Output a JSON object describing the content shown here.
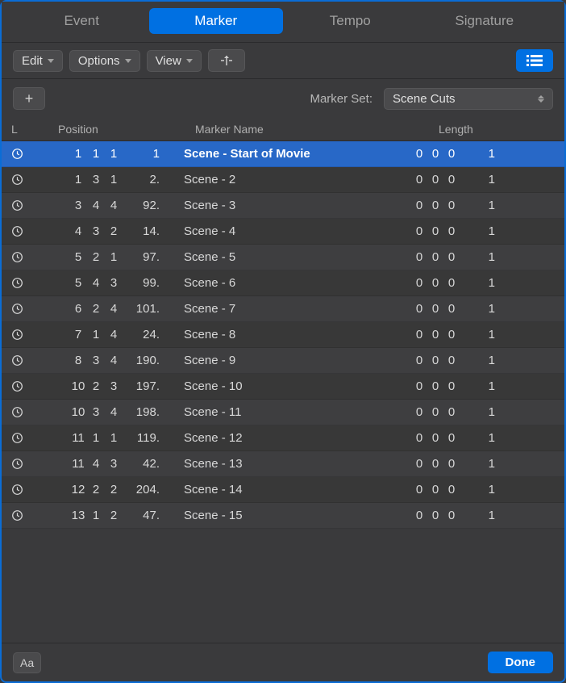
{
  "tabs": {
    "items": [
      {
        "label": "Event"
      },
      {
        "label": "Marker"
      },
      {
        "label": "Tempo"
      },
      {
        "label": "Signature"
      }
    ],
    "active_index": 1
  },
  "toolbar": {
    "edit": "Edit",
    "options": "Options",
    "view": "View"
  },
  "markerset": {
    "label": "Marker Set:",
    "value": "Scene Cuts"
  },
  "columns": {
    "l": "L",
    "position": "Position",
    "name": "Marker Name",
    "length": "Length"
  },
  "rows": [
    {
      "p1": "1",
      "p2": "1",
      "p3": "1",
      "p4": "1",
      "dot": false,
      "name": "Scene - Start of Movie",
      "l1": "0",
      "l2": "0",
      "l3": "0",
      "l4": "1",
      "selected": true
    },
    {
      "p1": "1",
      "p2": "3",
      "p3": "1",
      "p4": "2",
      "dot": true,
      "name": "Scene - 2",
      "l1": "0",
      "l2": "0",
      "l3": "0",
      "l4": "1"
    },
    {
      "p1": "3",
      "p2": "4",
      "p3": "4",
      "p4": "92",
      "dot": true,
      "name": "Scene - 3",
      "l1": "0",
      "l2": "0",
      "l3": "0",
      "l4": "1"
    },
    {
      "p1": "4",
      "p2": "3",
      "p3": "2",
      "p4": "14",
      "dot": true,
      "name": "Scene - 4",
      "l1": "0",
      "l2": "0",
      "l3": "0",
      "l4": "1"
    },
    {
      "p1": "5",
      "p2": "2",
      "p3": "1",
      "p4": "97",
      "dot": true,
      "name": "Scene - 5",
      "l1": "0",
      "l2": "0",
      "l3": "0",
      "l4": "1"
    },
    {
      "p1": "5",
      "p2": "4",
      "p3": "3",
      "p4": "99",
      "dot": true,
      "name": "Scene - 6",
      "l1": "0",
      "l2": "0",
      "l3": "0",
      "l4": "1"
    },
    {
      "p1": "6",
      "p2": "2",
      "p3": "4",
      "p4": "101",
      "dot": true,
      "name": "Scene - 7",
      "l1": "0",
      "l2": "0",
      "l3": "0",
      "l4": "1"
    },
    {
      "p1": "7",
      "p2": "1",
      "p3": "4",
      "p4": "24",
      "dot": true,
      "name": "Scene - 8",
      "l1": "0",
      "l2": "0",
      "l3": "0",
      "l4": "1"
    },
    {
      "p1": "8",
      "p2": "3",
      "p3": "4",
      "p4": "190",
      "dot": true,
      "name": "Scene - 9",
      "l1": "0",
      "l2": "0",
      "l3": "0",
      "l4": "1"
    },
    {
      "p1": "10",
      "p2": "2",
      "p3": "3",
      "p4": "197",
      "dot": true,
      "name": "Scene - 10",
      "l1": "0",
      "l2": "0",
      "l3": "0",
      "l4": "1"
    },
    {
      "p1": "10",
      "p2": "3",
      "p3": "4",
      "p4": "198",
      "dot": true,
      "name": "Scene - 11",
      "l1": "0",
      "l2": "0",
      "l3": "0",
      "l4": "1"
    },
    {
      "p1": "11",
      "p2": "1",
      "p3": "1",
      "p4": "119",
      "dot": true,
      "name": "Scene - 12",
      "l1": "0",
      "l2": "0",
      "l3": "0",
      "l4": "1"
    },
    {
      "p1": "11",
      "p2": "4",
      "p3": "3",
      "p4": "42",
      "dot": true,
      "name": "Scene - 13",
      "l1": "0",
      "l2": "0",
      "l3": "0",
      "l4": "1"
    },
    {
      "p1": "12",
      "p2": "2",
      "p3": "2",
      "p4": "204",
      "dot": true,
      "name": "Scene - 14",
      "l1": "0",
      "l2": "0",
      "l3": "0",
      "l4": "1"
    },
    {
      "p1": "13",
      "p2": "1",
      "p3": "2",
      "p4": "47",
      "dot": true,
      "name": "Scene - 15",
      "l1": "0",
      "l2": "0",
      "l3": "0",
      "l4": "1"
    }
  ],
  "footer": {
    "font": "Aa",
    "done": "Done"
  }
}
